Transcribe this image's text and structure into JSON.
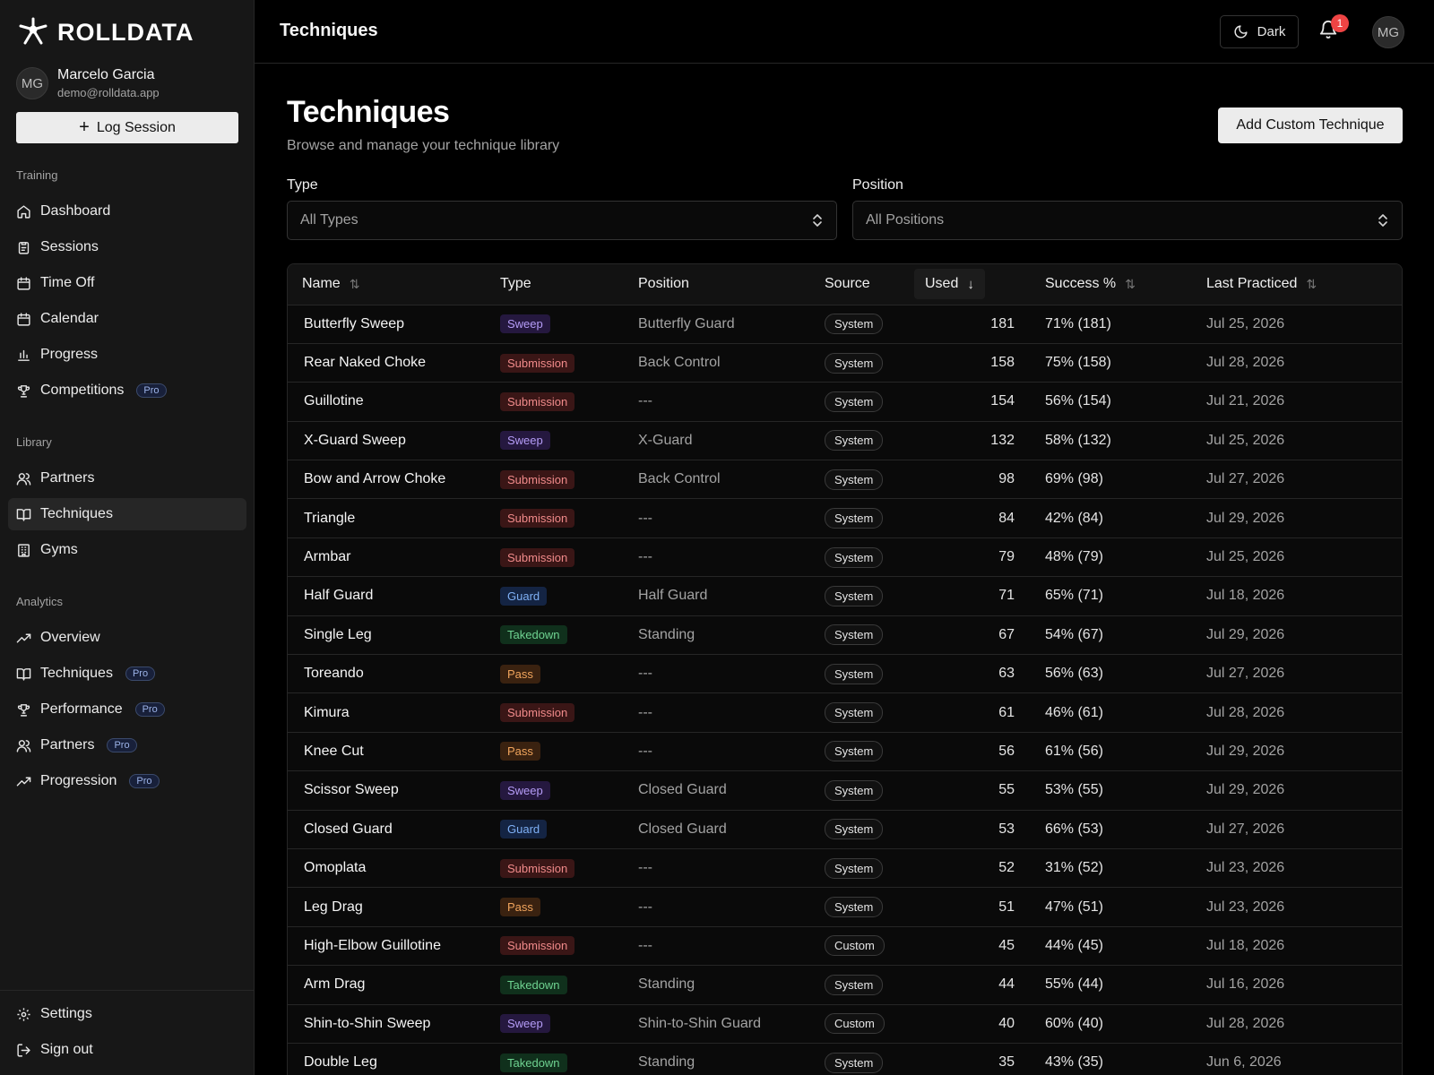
{
  "app": {
    "name": "ROLLDATA"
  },
  "user": {
    "initials": "MG",
    "name": "Marcelo Garcia",
    "email": "demo@rolldata.app"
  },
  "sidebar": {
    "log_session_label": "Log Session",
    "training_label": "Training",
    "training_items": [
      {
        "label": "Dashboard",
        "icon": "home-icon"
      },
      {
        "label": "Sessions",
        "icon": "clipboard-icon"
      },
      {
        "label": "Time Off",
        "icon": "calendar-icon"
      },
      {
        "label": "Calendar",
        "icon": "calendar-icon"
      },
      {
        "label": "Progress",
        "icon": "bar-chart-icon"
      },
      {
        "label": "Competitions",
        "icon": "trophy-icon",
        "pro": "Pro"
      }
    ],
    "library_label": "Library",
    "library_items": [
      {
        "label": "Partners",
        "icon": "users-icon"
      },
      {
        "label": "Techniques",
        "icon": "book-icon",
        "active": true
      },
      {
        "label": "Gyms",
        "icon": "building-icon"
      }
    ],
    "analytics_label": "Analytics",
    "analytics_items": [
      {
        "label": "Overview",
        "icon": "trend-icon"
      },
      {
        "label": "Techniques",
        "icon": "book-icon",
        "pro": "Pro"
      },
      {
        "label": "Performance",
        "icon": "trophy-icon",
        "pro": "Pro"
      },
      {
        "label": "Partners",
        "icon": "users-icon",
        "pro": "Pro"
      },
      {
        "label": "Progression",
        "icon": "trend-icon",
        "pro": "Pro"
      }
    ],
    "settings_label": "Settings",
    "signout_label": "Sign out"
  },
  "topbar": {
    "title": "Techniques",
    "theme_label": "Dark",
    "notification_count": "1",
    "avatar_initials": "MG"
  },
  "page": {
    "title": "Techniques",
    "subtitle": "Browse and manage your technique library",
    "add_button": "Add Custom Technique"
  },
  "filters": {
    "type_label": "Type",
    "type_value": "All Types",
    "position_label": "Position",
    "position_value": "All Positions"
  },
  "table": {
    "headers": {
      "name": "Name",
      "type": "Type",
      "position": "Position",
      "source": "Source",
      "used": "Used",
      "success": "Success %",
      "last": "Last Practiced"
    },
    "rows": [
      {
        "name": "Butterfly Sweep",
        "type": "Sweep",
        "position": "Butterfly Guard",
        "source": "System",
        "used": "181",
        "success": "71% (181)",
        "last": "Jul 25, 2026"
      },
      {
        "name": "Rear Naked Choke",
        "type": "Submission",
        "position": "Back Control",
        "source": "System",
        "used": "158",
        "success": "75% (158)",
        "last": "Jul 28, 2026"
      },
      {
        "name": "Guillotine",
        "type": "Submission",
        "position": "---",
        "source": "System",
        "used": "154",
        "success": "56% (154)",
        "last": "Jul 21, 2026"
      },
      {
        "name": "X-Guard Sweep",
        "type": "Sweep",
        "position": "X-Guard",
        "source": "System",
        "used": "132",
        "success": "58% (132)",
        "last": "Jul 25, 2026"
      },
      {
        "name": "Bow and Arrow Choke",
        "type": "Submission",
        "position": "Back Control",
        "source": "System",
        "used": "98",
        "success": "69% (98)",
        "last": "Jul 27, 2026"
      },
      {
        "name": "Triangle",
        "type": "Submission",
        "position": "---",
        "source": "System",
        "used": "84",
        "success": "42% (84)",
        "last": "Jul 29, 2026"
      },
      {
        "name": "Armbar",
        "type": "Submission",
        "position": "---",
        "source": "System",
        "used": "79",
        "success": "48% (79)",
        "last": "Jul 25, 2026"
      },
      {
        "name": "Half Guard",
        "type": "Guard",
        "position": "Half Guard",
        "source": "System",
        "used": "71",
        "success": "65% (71)",
        "last": "Jul 18, 2026"
      },
      {
        "name": "Single Leg",
        "type": "Takedown",
        "position": "Standing",
        "source": "System",
        "used": "67",
        "success": "54% (67)",
        "last": "Jul 29, 2026"
      },
      {
        "name": "Toreando",
        "type": "Pass",
        "position": "---",
        "source": "System",
        "used": "63",
        "success": "56% (63)",
        "last": "Jul 27, 2026"
      },
      {
        "name": "Kimura",
        "type": "Submission",
        "position": "---",
        "source": "System",
        "used": "61",
        "success": "46% (61)",
        "last": "Jul 28, 2026"
      },
      {
        "name": "Knee Cut",
        "type": "Pass",
        "position": "---",
        "source": "System",
        "used": "56",
        "success": "61% (56)",
        "last": "Jul 29, 2026"
      },
      {
        "name": "Scissor Sweep",
        "type": "Sweep",
        "position": "Closed Guard",
        "source": "System",
        "used": "55",
        "success": "53% (55)",
        "last": "Jul 29, 2026"
      },
      {
        "name": "Closed Guard",
        "type": "Guard",
        "position": "Closed Guard",
        "source": "System",
        "used": "53",
        "success": "66% (53)",
        "last": "Jul 27, 2026"
      },
      {
        "name": "Omoplata",
        "type": "Submission",
        "position": "---",
        "source": "System",
        "used": "52",
        "success": "31% (52)",
        "last": "Jul 23, 2026"
      },
      {
        "name": "Leg Drag",
        "type": "Pass",
        "position": "---",
        "source": "System",
        "used": "51",
        "success": "47% (51)",
        "last": "Jul 23, 2026"
      },
      {
        "name": "High-Elbow Guillotine",
        "type": "Submission",
        "position": "---",
        "source": "Custom",
        "used": "45",
        "success": "44% (45)",
        "last": "Jul 18, 2026"
      },
      {
        "name": "Arm Drag",
        "type": "Takedown",
        "position": "Standing",
        "source": "System",
        "used": "44",
        "success": "55% (44)",
        "last": "Jul 16, 2026"
      },
      {
        "name": "Shin-to-Shin Sweep",
        "type": "Sweep",
        "position": "Shin-to-Shin Guard",
        "source": "Custom",
        "used": "40",
        "success": "60% (40)",
        "last": "Jul 28, 2026"
      },
      {
        "name": "Double Leg",
        "type": "Takedown",
        "position": "Standing",
        "source": "System",
        "used": "35",
        "success": "43% (35)",
        "last": "Jun 6, 2026"
      }
    ]
  }
}
